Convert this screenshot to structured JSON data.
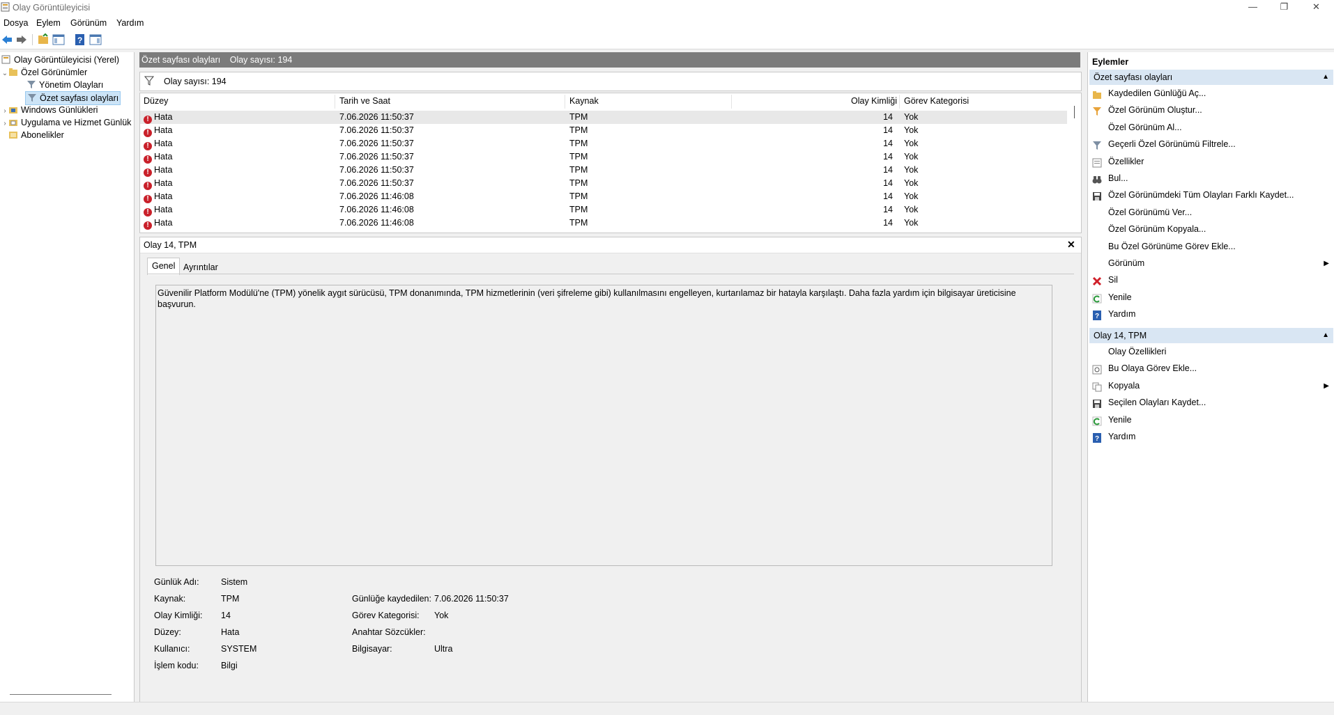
{
  "window": {
    "title": "Olay Görüntüleyicisi",
    "btn_min": "—",
    "btn_max": "❐",
    "btn_close": "✕"
  },
  "menu": [
    "Dosya",
    "Eylem",
    "Görünüm",
    "Yardım"
  ],
  "tree": {
    "root": "Olay Görüntüleyicisi (Yerel)",
    "custom_views": "Özel Görünümler",
    "admin_events": "Yönetim Olayları",
    "summary_events": "Özet sayfası olayları",
    "windows_logs": "Windows Günlükleri",
    "app_logs": "Uygulama ve Hizmet Günlük",
    "subscriptions": "Abonelikler"
  },
  "center": {
    "title": "Özet sayfası olayları",
    "count_label": "Olay sayısı: 194",
    "filter_count": "Olay sayısı: 194",
    "columns": [
      "Düzey",
      "Tarih ve Saat",
      "Kaynak",
      "Olay Kimliği",
      "Görev Kategorisi"
    ],
    "rows": [
      [
        "Hata",
        "7.06.2026 11:50:37",
        "TPM",
        "14",
        "Yok"
      ],
      [
        "Hata",
        "7.06.2026 11:50:37",
        "TPM",
        "14",
        "Yok"
      ],
      [
        "Hata",
        "7.06.2026 11:50:37",
        "TPM",
        "14",
        "Yok"
      ],
      [
        "Hata",
        "7.06.2026 11:50:37",
        "TPM",
        "14",
        "Yok"
      ],
      [
        "Hata",
        "7.06.2026 11:50:37",
        "TPM",
        "14",
        "Yok"
      ],
      [
        "Hata",
        "7.06.2026 11:50:37",
        "TPM",
        "14",
        "Yok"
      ],
      [
        "Hata",
        "7.06.2026 11:46:08",
        "TPM",
        "14",
        "Yok"
      ],
      [
        "Hata",
        "7.06.2026 11:46:08",
        "TPM",
        "14",
        "Yok"
      ],
      [
        "Hata",
        "7.06.2026 11:46:08",
        "TPM",
        "14",
        "Yok"
      ]
    ]
  },
  "detail": {
    "title": "Olay 14, TPM",
    "close": "✕",
    "tabs": [
      "Genel",
      "Ayrıntılar"
    ],
    "description": "Güvenilir Platform Modülü'ne (TPM) yönelik aygıt sürücüsü, TPM donanımında, TPM hizmetlerinin (veri şifreleme gibi) kullanılmasını engelleyen, kurtarılamaz bir hatayla karşılaştı. Daha fazla yardım için bilgisayar üreticisine başvurun.",
    "fields_left": [
      {
        "label": "Günlük Adı:",
        "value": "Sistem"
      },
      {
        "label": "Kaynak:",
        "value": "TPM"
      },
      {
        "label": "Olay Kimliği:",
        "value": "14"
      },
      {
        "label": "Düzey:",
        "value": "Hata"
      },
      {
        "label": "Kullanıcı:",
        "value": "SYSTEM"
      },
      {
        "label": "İşlem kodu:",
        "value": "Bilgi"
      }
    ],
    "fields_right": [
      {
        "label": "Günlüğe kaydedilen:",
        "value": "7.06.2026 11:50:37"
      },
      {
        "label": "Görev Kategorisi:",
        "value": "Yok"
      },
      {
        "label": "Anahtar Sözcükler:",
        "value": ""
      },
      {
        "label": "Bilgisayar:",
        "value": "Ultra"
      }
    ]
  },
  "actions": {
    "header": "Eylemler",
    "section1": "Özet sayfası olayları",
    "items1": [
      {
        "label": "Kaydedilen Günlüğü Aç...",
        "icon": "open-log-icon"
      },
      {
        "label": "Özel Görünüm Oluştur...",
        "icon": "filter-create-icon"
      },
      {
        "label": "Özel Görünüm Al...",
        "icon": ""
      },
      {
        "label": "Geçerli Özel Görünümü Filtrele...",
        "icon": "filter-icon"
      },
      {
        "label": "Özellikler",
        "icon": "properties-icon"
      },
      {
        "label": "Bul...",
        "icon": "binoculars-icon"
      },
      {
        "label": "Özel Görünümdeki Tüm Olayları Farklı Kaydet...",
        "icon": "save-icon"
      },
      {
        "label": "Özel Görünümü Ver...",
        "icon": ""
      },
      {
        "label": "Özel Görünüm Kopyala...",
        "icon": ""
      },
      {
        "label": "Bu Özel Görünüme Görev Ekle...",
        "icon": ""
      },
      {
        "label": "Görünüm",
        "icon": "",
        "submenu": true
      },
      {
        "label": "Sil",
        "icon": "delete-icon"
      },
      {
        "label": "Yenile",
        "icon": "refresh-icon"
      },
      {
        "label": "Yardım",
        "icon": "help-icon"
      }
    ],
    "section2": "Olay 14, TPM",
    "items2": [
      {
        "label": "Olay Özellikleri",
        "icon": ""
      },
      {
        "label": "Bu Olaya Görev Ekle...",
        "icon": "task-icon"
      },
      {
        "label": "Kopyala",
        "icon": "copy-icon",
        "submenu": true
      },
      {
        "label": "Seçilen Olayları Kaydet...",
        "icon": "save-icon"
      },
      {
        "label": "Yenile",
        "icon": "refresh-icon"
      },
      {
        "label": "Yardım",
        "icon": "help-icon"
      }
    ],
    "collapse": "▲",
    "submenu_arrow": "▶"
  },
  "colors": {
    "accent_header": "#d9e6f3",
    "panel_head": "#7b7b7b",
    "error": "#c9202a"
  }
}
